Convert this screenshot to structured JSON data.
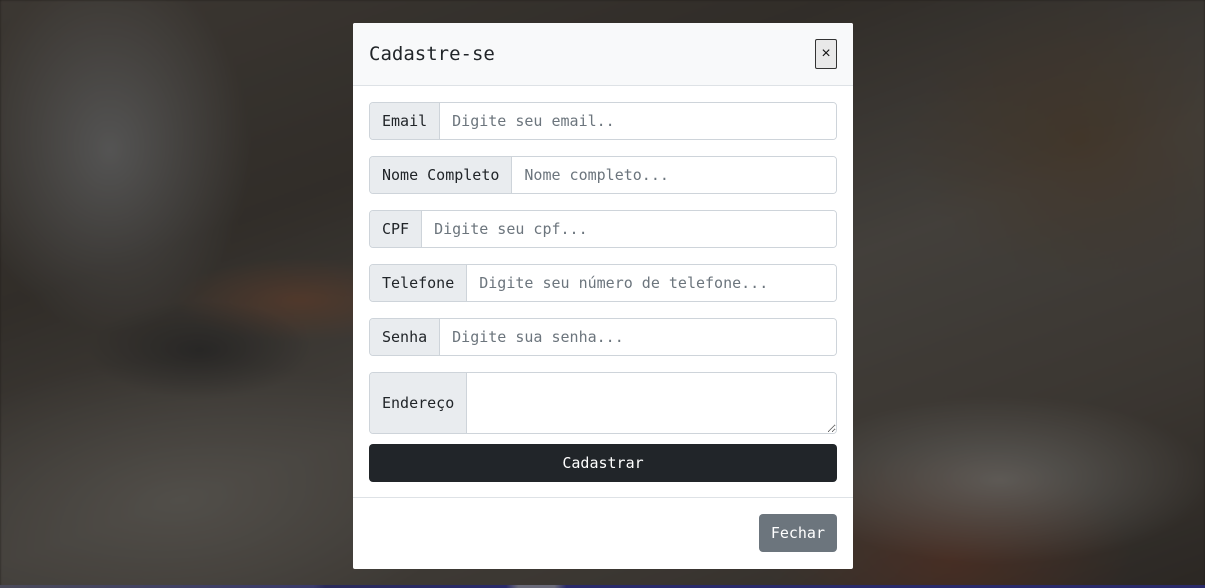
{
  "modal": {
    "title": "Cadastre-se",
    "close_label": "×",
    "fields": {
      "email": {
        "label": "Email",
        "placeholder": "Digite seu email..",
        "value": ""
      },
      "name": {
        "label": "Nome Completo",
        "placeholder": "Nome completo...",
        "value": ""
      },
      "cpf": {
        "label": "CPF",
        "placeholder": "Digite seu cpf...",
        "value": ""
      },
      "phone": {
        "label": "Telefone",
        "placeholder": "Digite seu número de telefone...",
        "value": ""
      },
      "password": {
        "label": "Senha",
        "placeholder": "Digite sua senha...",
        "value": ""
      },
      "address": {
        "label": "Endereço",
        "placeholder": "",
        "value": ""
      }
    },
    "submit_label": "Cadastrar",
    "footer_close_label": "Fechar"
  },
  "colors": {
    "primary_dark": "#212529",
    "secondary": "#6c757d",
    "addon_bg": "#e9ecef"
  }
}
